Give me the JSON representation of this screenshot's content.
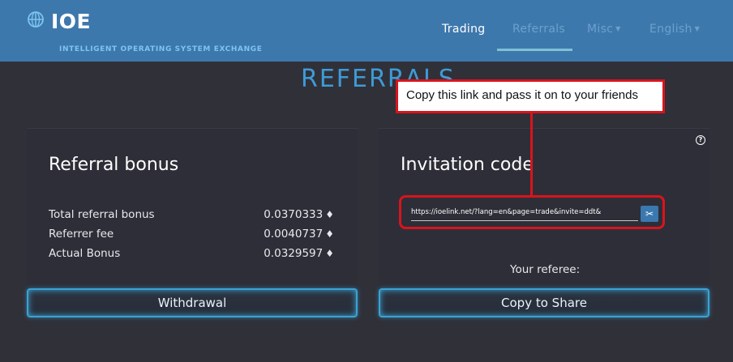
{
  "brand": {
    "name": "IOE",
    "tagline": "INTELLIGENT OPERATING SYSTEM EXCHANGE",
    "logo_icon": "globe-icon"
  },
  "nav": {
    "items": [
      {
        "label": "Trading",
        "active": false
      },
      {
        "label": "Referrals",
        "active": true
      },
      {
        "label": "Misc",
        "dropdown": true
      },
      {
        "label": "English",
        "dropdown": true
      }
    ]
  },
  "page_title": "REFERRALS",
  "referral_bonus": {
    "title": "Referral bonus",
    "rows": [
      {
        "label": "Total referral bonus",
        "value": "0.0370333"
      },
      {
        "label": "Referrer fee",
        "value": "0.0040737"
      },
      {
        "label": "Actual Bonus",
        "value": "0.0329597"
      }
    ],
    "currency_icon": "ethereum-diamond-icon",
    "withdraw_label": "Withdrawal"
  },
  "invitation": {
    "title": "Invitation code",
    "link": "https://ioelink.net/?lang=en&page=trade&invite=ddt&",
    "copy_icon": "scissors-icon",
    "referee_label": "Your referee:",
    "share_label": "Copy to Share",
    "help_icon": "question-icon"
  },
  "annotation": {
    "text": "Copy this link and pass it on to your friends"
  },
  "colors": {
    "header": "#3d78ad",
    "background": "#303039",
    "accent": "#3aa2d4",
    "annotation": "#d9141c"
  }
}
